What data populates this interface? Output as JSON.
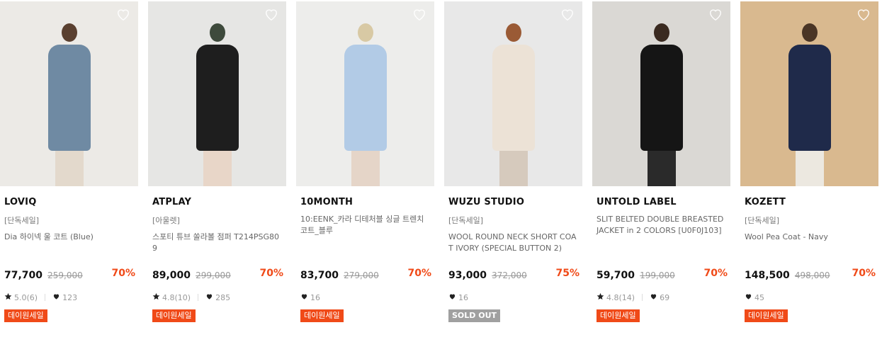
{
  "products": [
    {
      "brand": "LOVIQ",
      "tag": "[단독세일]",
      "name": "Dia 하이넥 울 코트 (Blue)",
      "price": "77,700",
      "original_price": "259,000",
      "discount": "70%",
      "rating": "5.0(6)",
      "likes": "123",
      "badge": "데이원세일",
      "photo": {
        "bg": "#eceae6",
        "coat": "#6f8aa3",
        "legs": "#e3d9cc",
        "hair": "#5a4030"
      }
    },
    {
      "brand": "ATPLAY",
      "tag": "[아울렛]",
      "name": "스포티 튜브 쏠라볼 점퍼 T214PSG809",
      "price": "89,000",
      "original_price": "299,000",
      "discount": "70%",
      "rating": "4.8(10)",
      "likes": "285",
      "badge": "데이원세일",
      "photo": {
        "bg": "#e6e6e4",
        "coat": "#1e1e1e",
        "legs": "#e8d6c8",
        "hair": "#3e4a3c"
      }
    },
    {
      "brand": "10MONTH",
      "tag": "",
      "name": "10:EENK_카라 디테처블 싱글 트렌치 코트_블루",
      "price": "83,700",
      "original_price": "279,000",
      "discount": "70%",
      "rating": "",
      "likes": "16",
      "badge": "데이원세일",
      "photo": {
        "bg": "#ededeb",
        "coat": "#b2cbe6",
        "legs": "#e5d5c8",
        "hair": "#d8c9a4"
      }
    },
    {
      "brand": "WUZU STUDIO",
      "tag": "[단독세일]",
      "name": "WOOL ROUND NECK SHORT COAT IVORY (SPECIAL BUTTON 2)",
      "price": "93,000",
      "original_price": "372,000",
      "discount": "75%",
      "rating": "",
      "likes": "16",
      "badge": "SOLD OUT",
      "badge_type": "soldout",
      "photo": {
        "bg": "#e8e8e8",
        "coat": "#ece2d6",
        "legs": "#d6cabd",
        "hair": "#9a5a35"
      }
    },
    {
      "brand": "UNTOLD LABEL",
      "tag": "",
      "name": "SLIT BELTED DOUBLE BREASTED JACKET in 2 COLORS [U0F0J103]",
      "price": "59,700",
      "original_price": "199,000",
      "discount": "70%",
      "rating": "4.8(14)",
      "likes": "69",
      "badge": "데이원세일",
      "photo": {
        "bg": "#dad8d4",
        "coat": "#151515",
        "legs": "#2a2a2a",
        "hair": "#3a2a20"
      }
    },
    {
      "brand": "KOZETT",
      "tag": "[단독세일]",
      "name": "Wool Pea Coat - Navy",
      "price": "148,500",
      "original_price": "498,000",
      "discount": "70%",
      "rating": "",
      "likes": "45",
      "badge": "데이원세일",
      "photo": {
        "bg": "#d9b98f",
        "coat": "#1f2a4a",
        "legs": "#ece8e0",
        "hair": "#4a3525"
      }
    }
  ],
  "icons": {
    "wishlist": "heart-outline-icon",
    "rating": "star-icon",
    "likes": "heart-icon"
  },
  "colors": {
    "discount": "#f04a18",
    "badge": "#f04a18",
    "soldout": "#a0a0a0"
  }
}
